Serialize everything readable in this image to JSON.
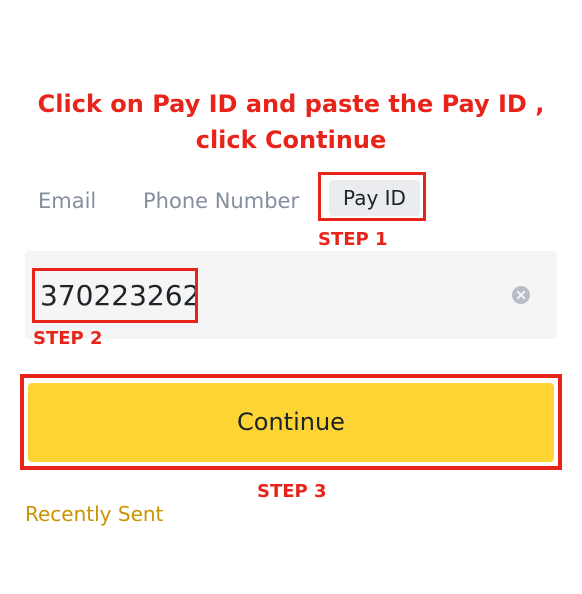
{
  "instruction": {
    "line1": "Click on Pay ID and paste the Pay ID ,",
    "line2": "click Continue"
  },
  "tabs": {
    "email": "Email",
    "phone": "Phone Number",
    "pay_id": "Pay ID"
  },
  "steps": {
    "step1": "STEP 1",
    "step2": "STEP 2",
    "step3": "STEP 3"
  },
  "pay_id_input": {
    "value": "370223262"
  },
  "icons": {
    "clear": "clear-icon"
  },
  "continue_button": {
    "label": "Continue"
  },
  "recently_sent": {
    "label": "Recently Sent"
  },
  "colors": {
    "annotation_red": "#e8241a",
    "button_yellow": "#fcd535",
    "link_gold": "#c99400",
    "tab_active_bg": "#eaecef",
    "input_bg": "#f5f5f5"
  }
}
